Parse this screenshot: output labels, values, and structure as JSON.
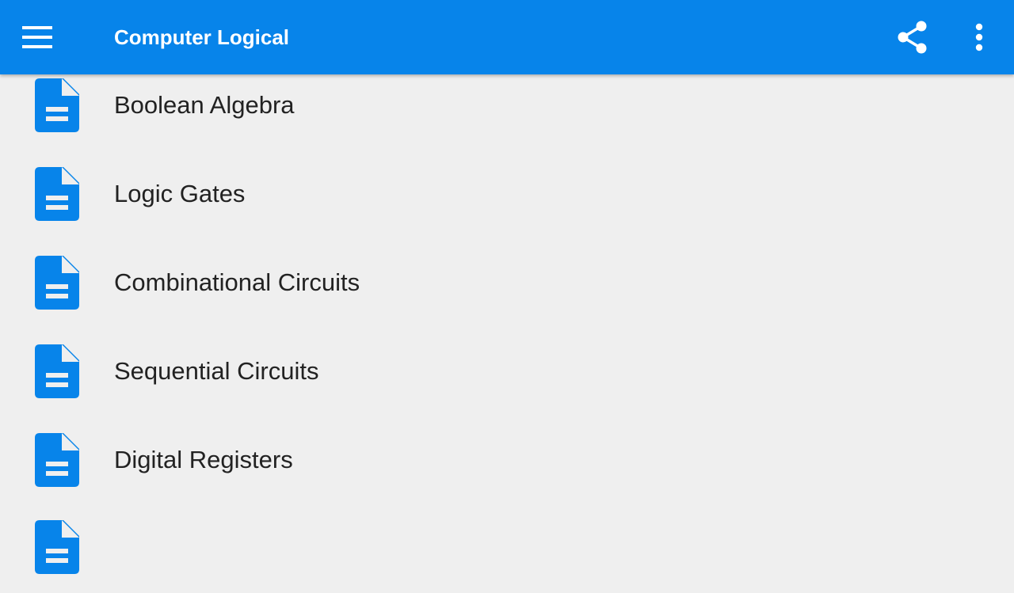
{
  "appbar": {
    "title": "Computer Logical",
    "background_color": "#0784ea",
    "menu_icon": "hamburger-menu-icon",
    "share_icon": "share-icon",
    "more_icon": "more-vertical-icon"
  },
  "list": {
    "item_icon": "document-icon",
    "icon_color": "#0784ea",
    "items": [
      {
        "label": "Boolean Algebra"
      },
      {
        "label": "Logic Gates"
      },
      {
        "label": "Combinational Circuits"
      },
      {
        "label": "Sequential Circuits"
      },
      {
        "label": "Digital Registers"
      },
      {
        "label": ""
      }
    ]
  }
}
